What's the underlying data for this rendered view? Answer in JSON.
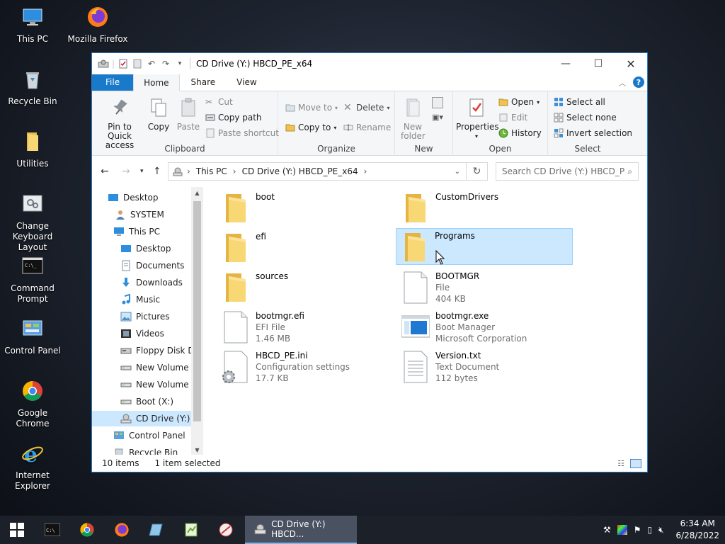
{
  "desktop": {
    "icons": [
      {
        "label": "This PC",
        "icon": "this-pc-icon"
      },
      {
        "label": "Mozilla Firefox",
        "icon": "firefox-icon"
      },
      {
        "label": "Recycle Bin",
        "icon": "recycle-bin-icon"
      },
      {
        "label": "Utilities",
        "icon": "folder-icon"
      },
      {
        "label": "Change Keyboard Layout",
        "icon": "keyboard-layout-icon"
      },
      {
        "label": "Command Prompt",
        "icon": "cmd-icon"
      },
      {
        "label": "Control Panel",
        "icon": "control-panel-icon"
      },
      {
        "label": "Google Chrome",
        "icon": "chrome-icon"
      },
      {
        "label": "Internet Explorer",
        "icon": "ie-icon"
      }
    ]
  },
  "window": {
    "title": "CD Drive (Y:) HBCD_PE_x64",
    "accent": "#1979ca"
  },
  "ribbon": {
    "tabs": [
      "File",
      "Home",
      "Share",
      "View"
    ],
    "clipboard": {
      "label": "Clipboard",
      "pin": "Pin to Quick access",
      "copy": "Copy",
      "paste": "Paste",
      "cut": "Cut",
      "copy_path": "Copy path",
      "paste_shortcut": "Paste shortcut"
    },
    "organize": {
      "label": "Organize",
      "move_to": "Move to",
      "copy_to": "Copy to",
      "delete": "Delete",
      "rename": "Rename"
    },
    "new": {
      "label": "New",
      "new_folder": "New folder"
    },
    "open": {
      "label": "Open",
      "properties": "Properties",
      "open": "Open",
      "edit": "Edit",
      "history": "History"
    },
    "select": {
      "label": "Select",
      "select_all": "Select all",
      "select_none": "Select none",
      "invert": "Invert selection"
    }
  },
  "address": {
    "crumbs": [
      "This PC",
      "CD Drive (Y:) HBCD_PE_x64"
    ],
    "search_placeholder": "Search CD Drive (Y:) HBCD_PE..."
  },
  "nav": {
    "items": [
      {
        "label": "Desktop",
        "icon": "desktop-icon"
      },
      {
        "label": "SYSTEM",
        "icon": "user-icon"
      },
      {
        "label": "This PC",
        "icon": "this-pc-icon"
      },
      {
        "label": "Desktop",
        "icon": "desktop-icon"
      },
      {
        "label": "Documents",
        "icon": "documents-icon"
      },
      {
        "label": "Downloads",
        "icon": "downloads-icon"
      },
      {
        "label": "Music",
        "icon": "music-icon"
      },
      {
        "label": "Pictures",
        "icon": "pictures-icon"
      },
      {
        "label": "Videos",
        "icon": "videos-icon"
      },
      {
        "label": "Floppy Disk Dri",
        "icon": "floppy-icon"
      },
      {
        "label": "New Volume (C",
        "icon": "drive-icon"
      },
      {
        "label": "New Volume (D",
        "icon": "drive-icon"
      },
      {
        "label": "Boot (X:)",
        "icon": "drive-icon"
      },
      {
        "label": "CD Drive (Y:) H",
        "icon": "cd-drive-icon"
      },
      {
        "label": "Control Panel",
        "icon": "control-panel-icon"
      },
      {
        "label": "Recycle Bin",
        "icon": "recycle-bin-icon"
      }
    ]
  },
  "files": [
    {
      "name": "boot",
      "type": "folder"
    },
    {
      "name": "CustomDrivers",
      "type": "folder"
    },
    {
      "name": "efi",
      "type": "folder"
    },
    {
      "name": "Programs",
      "type": "folder",
      "selected": true
    },
    {
      "name": "sources",
      "type": "folder"
    },
    {
      "name": "BOOTMGR",
      "type": "file",
      "line2": "File",
      "line3": "404 KB"
    },
    {
      "name": "bootmgr.efi",
      "type": "file",
      "line2": "EFI File",
      "line3": "1.46 MB"
    },
    {
      "name": "bootmgr.exe",
      "type": "exe",
      "line2": "Boot Manager",
      "line3": "Microsoft Corporation"
    },
    {
      "name": "HBCD_PE.ini",
      "type": "ini",
      "line2": "Configuration settings",
      "line3": "17.7 KB"
    },
    {
      "name": "Version.txt",
      "type": "txt",
      "line2": "Text Document",
      "line3": "112 bytes"
    }
  ],
  "status": {
    "count": "10 items",
    "selected": "1 item selected"
  },
  "taskbar": {
    "active_label": "CD Drive (Y:) HBCD...",
    "time": "6:34 AM",
    "date": "6/28/2022"
  }
}
